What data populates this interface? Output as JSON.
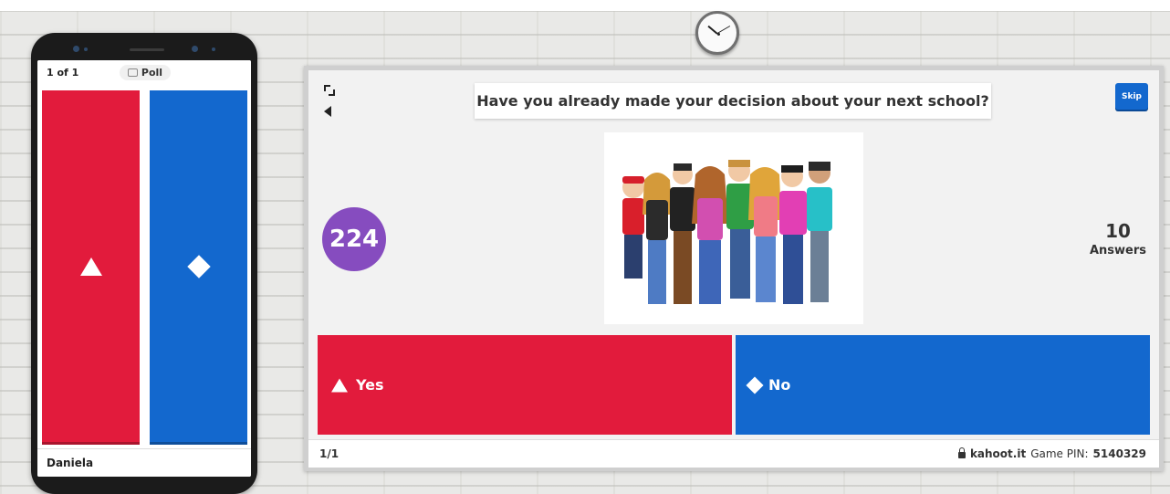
{
  "phone": {
    "question_count": "1 of 1",
    "question_type": "Poll",
    "player_name": "Daniela",
    "answer_buttons": [
      {
        "shape_icon": "triangle-icon",
        "color": "#e21b3c"
      },
      {
        "shape_icon": "diamond-icon",
        "color": "#1368ce"
      }
    ]
  },
  "presenter": {
    "question": "Have you already made your decision about your next school?",
    "skip_label": "Skip",
    "timer": "224",
    "answers_count": "10",
    "answers_label": "Answers",
    "options": [
      {
        "label": "Yes",
        "shape_icon": "triangle-icon",
        "color": "#e21b3c"
      },
      {
        "label": "No",
        "shape_icon": "diamond-icon",
        "color": "#1368ce"
      }
    ],
    "footer": {
      "progress": "1/1",
      "site": "kahoot.it",
      "pin_label": "Game PIN:",
      "pin": "5140329"
    }
  },
  "colors": {
    "red": "#e21b3c",
    "blue": "#1368ce",
    "purple": "#864cbf"
  }
}
